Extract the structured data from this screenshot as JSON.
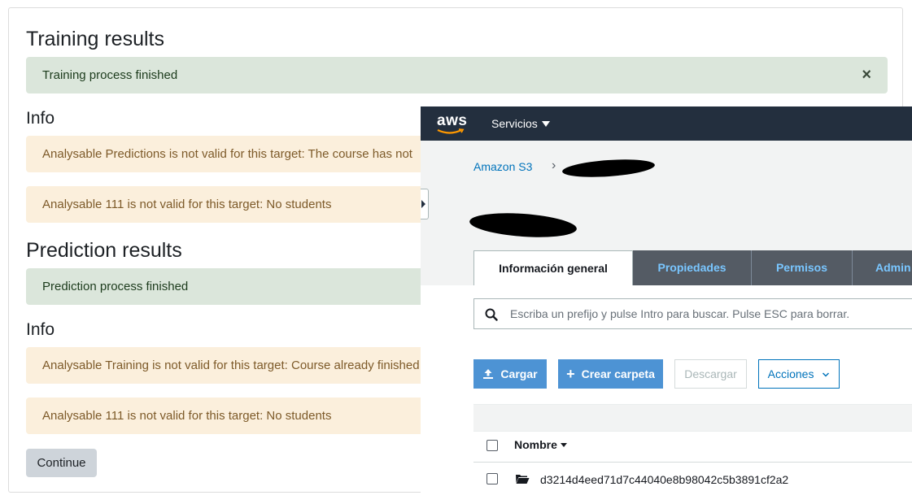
{
  "moodle": {
    "training_heading": "Training results",
    "training_alert": "Training process finished",
    "close_symbol": "×",
    "info_heading_1": "Info",
    "info_alerts_1": [
      "Analysable Predictions is not valid for this target: The course has not",
      "Analysable 111 is not valid for this target: No students"
    ],
    "prediction_heading": "Prediction results",
    "prediction_alert": "Prediction process finished",
    "info_heading_2": "Info",
    "info_alerts_2": [
      "Analysable Training is not valid for this target: Course already finished",
      "Analysable 111 is not valid for this target: No students"
    ],
    "continue_label": "Continue",
    "colors": {
      "success_bg": "#dbe6db",
      "warning_bg": "#fbefdc",
      "button_bg": "#ced4da"
    }
  },
  "aws": {
    "logo_text": "aws",
    "services_label": "Servicios",
    "breadcrumb_root": "Amazon S3",
    "breadcrumb_separator": "›",
    "tabs": [
      "Información general",
      "Propiedades",
      "Permisos",
      "Admin"
    ],
    "search_placeholder": "Escriba un prefijo y pulse Intro para buscar. Pulse ESC para borrar.",
    "buttons": {
      "upload": "Cargar",
      "create_folder": "Crear carpeta",
      "download": "Descargar",
      "actions": "Acciones"
    },
    "column_name": "Nombre",
    "folder_name": "d3214d4eed71d7c44040e8b98042c5b3891cf2a2",
    "icons": [
      "upload-icon",
      "plus-icon",
      "search-icon",
      "folder-icon",
      "chevron-down-icon"
    ],
    "colors": {
      "nav_bg": "#232f3e",
      "primary_button": "#4d93d4",
      "link": "#0073bb",
      "tab_inactive_bg": "#545b64",
      "tab_inactive_text": "#79c6ff"
    }
  }
}
